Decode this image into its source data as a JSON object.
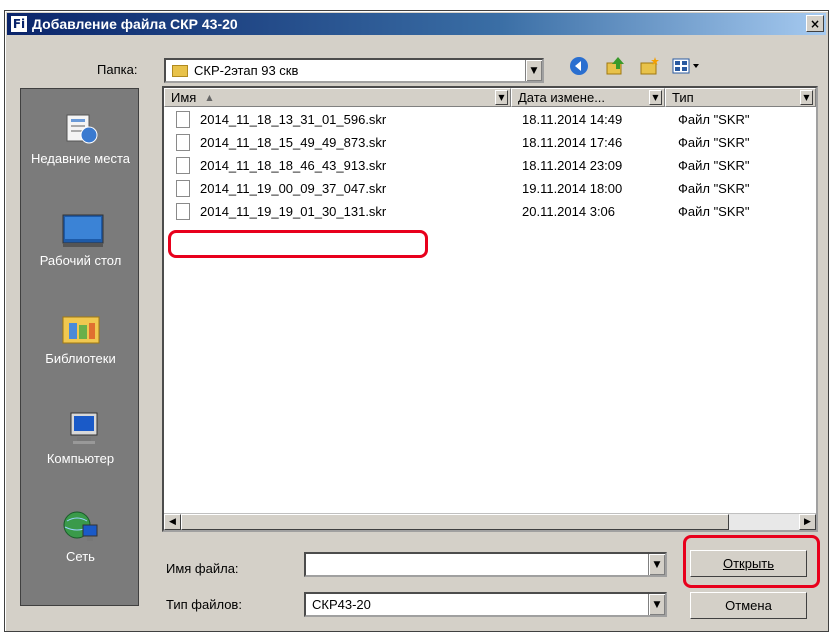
{
  "window": {
    "app_icon_label": "Fi",
    "title": "Добавление файла СКР 43-20",
    "close_glyph": "×"
  },
  "folder": {
    "label": "Папка:",
    "value": "СКР-2этап 93 скв"
  },
  "places": [
    {
      "label": "Недавние места",
      "icon": "recent-places-icon"
    },
    {
      "label": "Рабочий стол",
      "icon": "desktop-icon"
    },
    {
      "label": "Библиотеки",
      "icon": "libraries-icon"
    },
    {
      "label": "Компьютер",
      "icon": "computer-icon"
    },
    {
      "label": "Сеть",
      "icon": "network-icon"
    }
  ],
  "columns": {
    "name": "Имя",
    "date": "Дата измене...",
    "type": "Тип"
  },
  "files": [
    {
      "name": "2014_11_18_13_31_01_596.skr",
      "date": "18.11.2014 14:49",
      "type": "Файл \"SKR\""
    },
    {
      "name": "2014_11_18_15_49_49_873.skr",
      "date": "18.11.2014 17:46",
      "type": "Файл \"SKR\""
    },
    {
      "name": "2014_11_18_18_46_43_913.skr",
      "date": "18.11.2014 23:09",
      "type": "Файл \"SKR\""
    },
    {
      "name": "2014_11_19_00_09_37_047.skr",
      "date": "19.11.2014 18:00",
      "type": "Файл \"SKR\""
    },
    {
      "name": "2014_11_19_19_01_30_131.skr",
      "date": "20.11.2014 3:06",
      "type": "Файл \"SKR\""
    }
  ],
  "filename": {
    "label": "Имя файла:",
    "value": ""
  },
  "filetype": {
    "label": "Тип файлов:",
    "value": "СКР43-20"
  },
  "buttons": {
    "open": "Открыть",
    "cancel": "Отмена"
  },
  "colors": {
    "highlight": "#e8001c",
    "title_start": "#0a246a",
    "places_bg": "#7b7b7b"
  }
}
